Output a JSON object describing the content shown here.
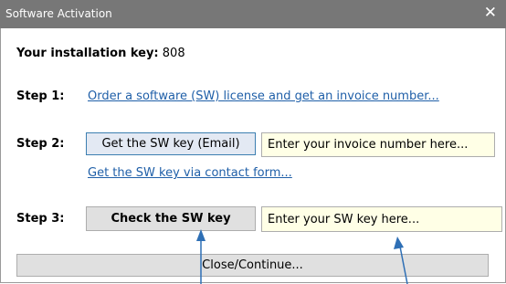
{
  "window": {
    "title": "Software Activation",
    "close_symbol": "✕"
  },
  "installation": {
    "label": "Your installation key:",
    "value": "808"
  },
  "steps": [
    {
      "label": "Step 1:",
      "link": "Order a software (SW) license and get an invoice number..."
    },
    {
      "label": "Step 2:",
      "button": "Get the SW key (Email)",
      "placeholder": "Enter your invoice number here...",
      "link": "Get the SW key via contact form..."
    },
    {
      "label": "Step 3:",
      "button": "Check the SW key",
      "placeholder": "Enter your SW key here..."
    }
  ],
  "footer": {
    "close_button": "Close/Continue..."
  },
  "colors": {
    "titlebar": "#777777",
    "link": "#1f5fa8",
    "input_background": "#ffffe6",
    "arrow": "#2e6fb5"
  },
  "icons": [
    "close-icon",
    "arrow-up-icon"
  ]
}
